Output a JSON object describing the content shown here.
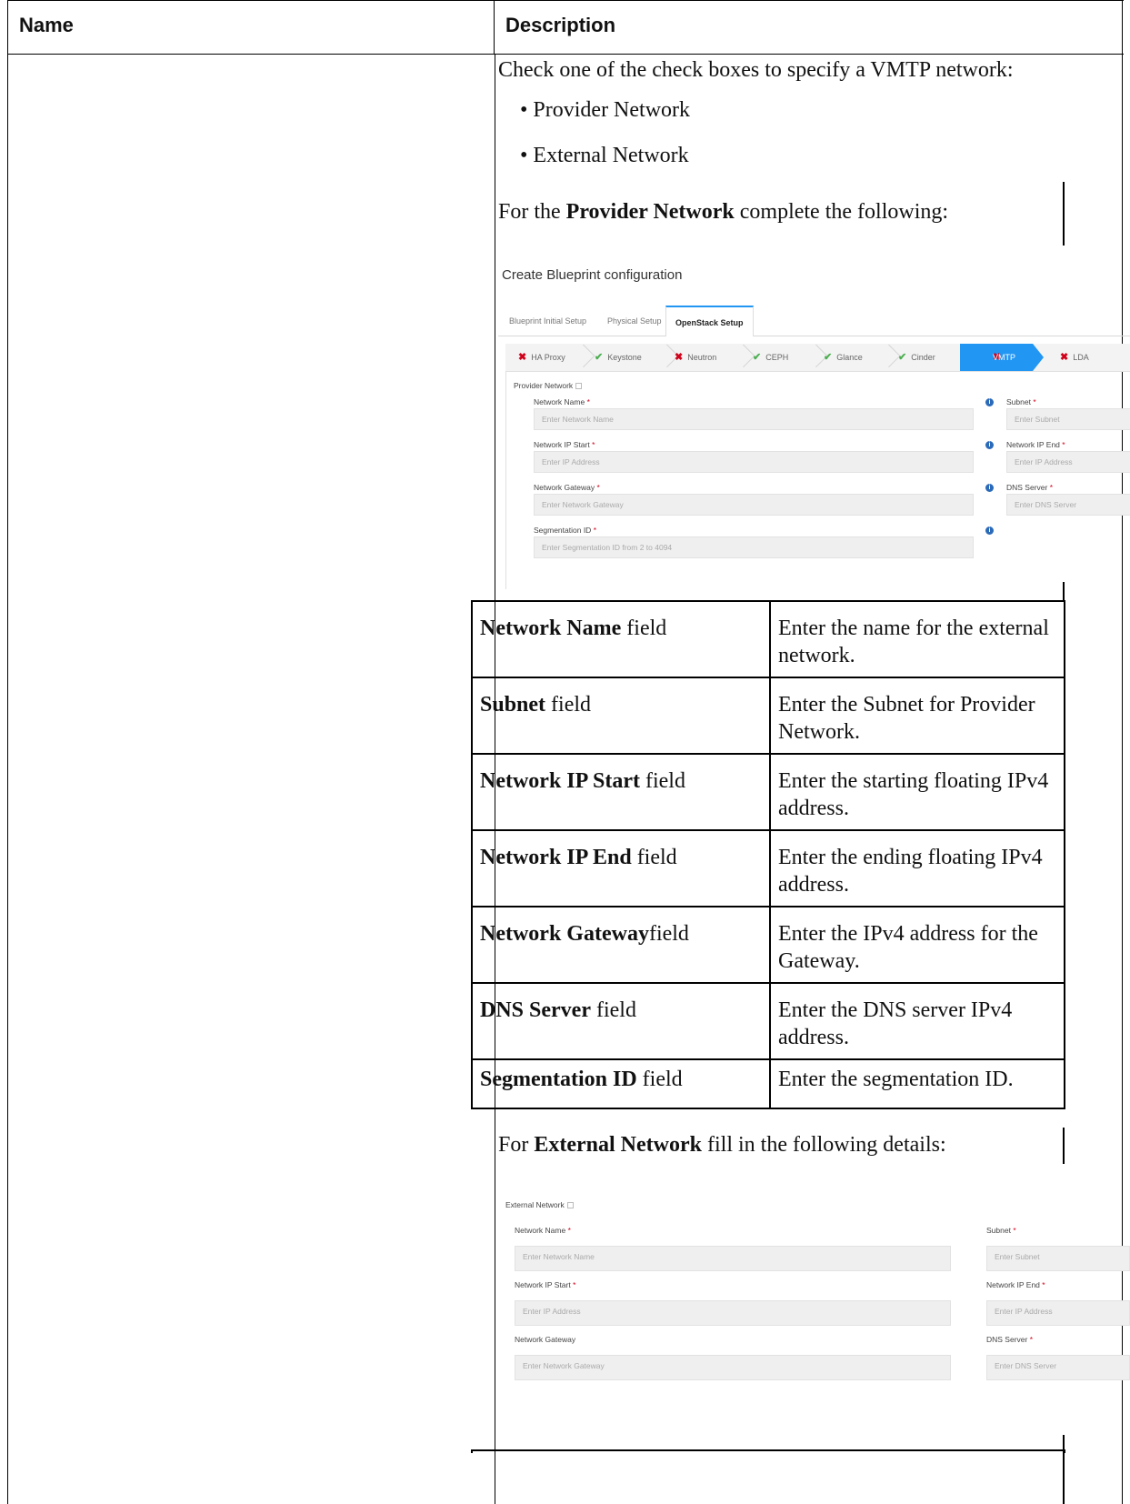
{
  "header": {
    "name": "Name",
    "description": "Description"
  },
  "intro": "Check one of the check boxes to specify a VMTP network:",
  "bullets": [
    "• Provider Network",
    "• External Network"
  ],
  "provider_para": {
    "pre": "For the ",
    "bold": "Provider Network",
    "post": " complete the following:"
  },
  "shot1": {
    "title": "Create Blueprint configuration",
    "tabs": [
      "Blueprint Initial Setup",
      "Physical Setup",
      "OpenStack Setup"
    ],
    "steps": [
      "HA Proxy",
      "Keystone",
      "Neutron",
      "CEPH",
      "Glance",
      "Cinder",
      "VMTP",
      "LDA"
    ],
    "section": "Provider Network",
    "fields": {
      "network_name": {
        "label": "Network Name",
        "placeholder": "Enter Network Name"
      },
      "subnet": {
        "label": "Subnet",
        "placeholder": "Enter Subnet"
      },
      "ip_start": {
        "label": "Network IP Start",
        "placeholder": "Enter IP Address"
      },
      "ip_end": {
        "label": "Network IP End",
        "placeholder": "Enter IP Address"
      },
      "gateway": {
        "label": "Network Gateway",
        "placeholder": "Enter Network Gateway"
      },
      "dns": {
        "label": "DNS Server",
        "placeholder": "Enter DNS Server"
      },
      "seg": {
        "label": "Segmentation ID",
        "placeholder": "Enter Segmentation ID from 2 to 4094"
      }
    }
  },
  "rows": [
    {
      "bold": "Network Name",
      "rest": " field",
      "desc": [
        "Enter the name for the external",
        "network."
      ]
    },
    {
      "bold": "Subnet",
      "rest": " field",
      "desc": [
        "Enter the Subnet for Provider",
        "Network."
      ]
    },
    {
      "bold": "Network IP Start",
      "rest": "  field",
      "desc": [
        "Enter the starting floating IPv4",
        "address."
      ]
    },
    {
      "bold": "Network IP End",
      "rest": "  field",
      "desc": [
        "Enter the ending floating IPv4",
        "address."
      ]
    },
    {
      "bold": "Network Gateway",
      "rest": "field",
      "desc": [
        "Enter the IPv4 address for the",
        "Gateway."
      ]
    },
    {
      "bold": "DNS Server",
      "rest": " field",
      "desc": [
        "Enter the DNS server IPv4",
        "address."
      ]
    },
    {
      "bold": "Segmentation ID",
      "rest": "  field",
      "desc": [
        "Enter the segmentation ID."
      ]
    }
  ],
  "external_para": {
    "pre": "For ",
    "bold": "External Network",
    "post": " fill in the following details:"
  },
  "shot2": {
    "section": "External Network",
    "fields": {
      "network_name": {
        "label": "Network Name",
        "placeholder": "Enter Network Name"
      },
      "subnet": {
        "label": "Subnet",
        "placeholder": "Enter Subnet"
      },
      "ip_start": {
        "label": "Network IP Start",
        "placeholder": "Enter IP Address"
      },
      "ip_end": {
        "label": "Network IP End",
        "placeholder": "Enter IP Address"
      },
      "gateway": {
        "label": "Network Gateway",
        "placeholder": "Enter Network Gateway"
      },
      "dns": {
        "label": "DNS Server",
        "placeholder": "Enter DNS Server"
      }
    }
  }
}
